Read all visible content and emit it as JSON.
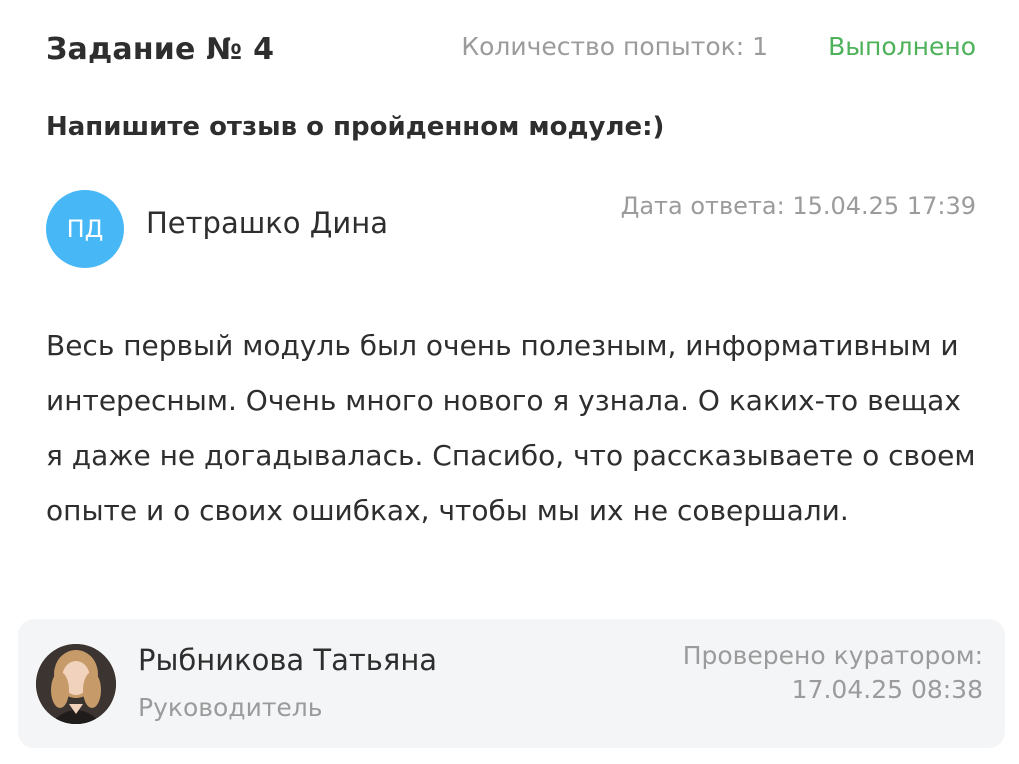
{
  "task": {
    "title": "Задание № 4",
    "attempts": "Количество попыток: 1",
    "status": "Выполнено",
    "status_color": "#4db25a",
    "question": "Напишите отзыв о пройденном модуле:)"
  },
  "answer": {
    "author_initials": "ПД",
    "author_name": "Петрашко Дина",
    "avatar_color": "#47b7f6",
    "date": "Дата ответа: 15.04.25 17:39",
    "text": "Весь первый модуль был очень полезным, информативным и интересным. Очень много нового я узнала. О каких-то вещах я даже не догадывалась. Спасибо, что рассказываете о своем опыте и о своих ошибках, чтобы мы их не совершали."
  },
  "curator": {
    "name": "Рыбникова Татьяна",
    "role": "Руководитель",
    "checked_label": "Проверено куратором:",
    "checked_date": "17.04.25 08:38"
  }
}
